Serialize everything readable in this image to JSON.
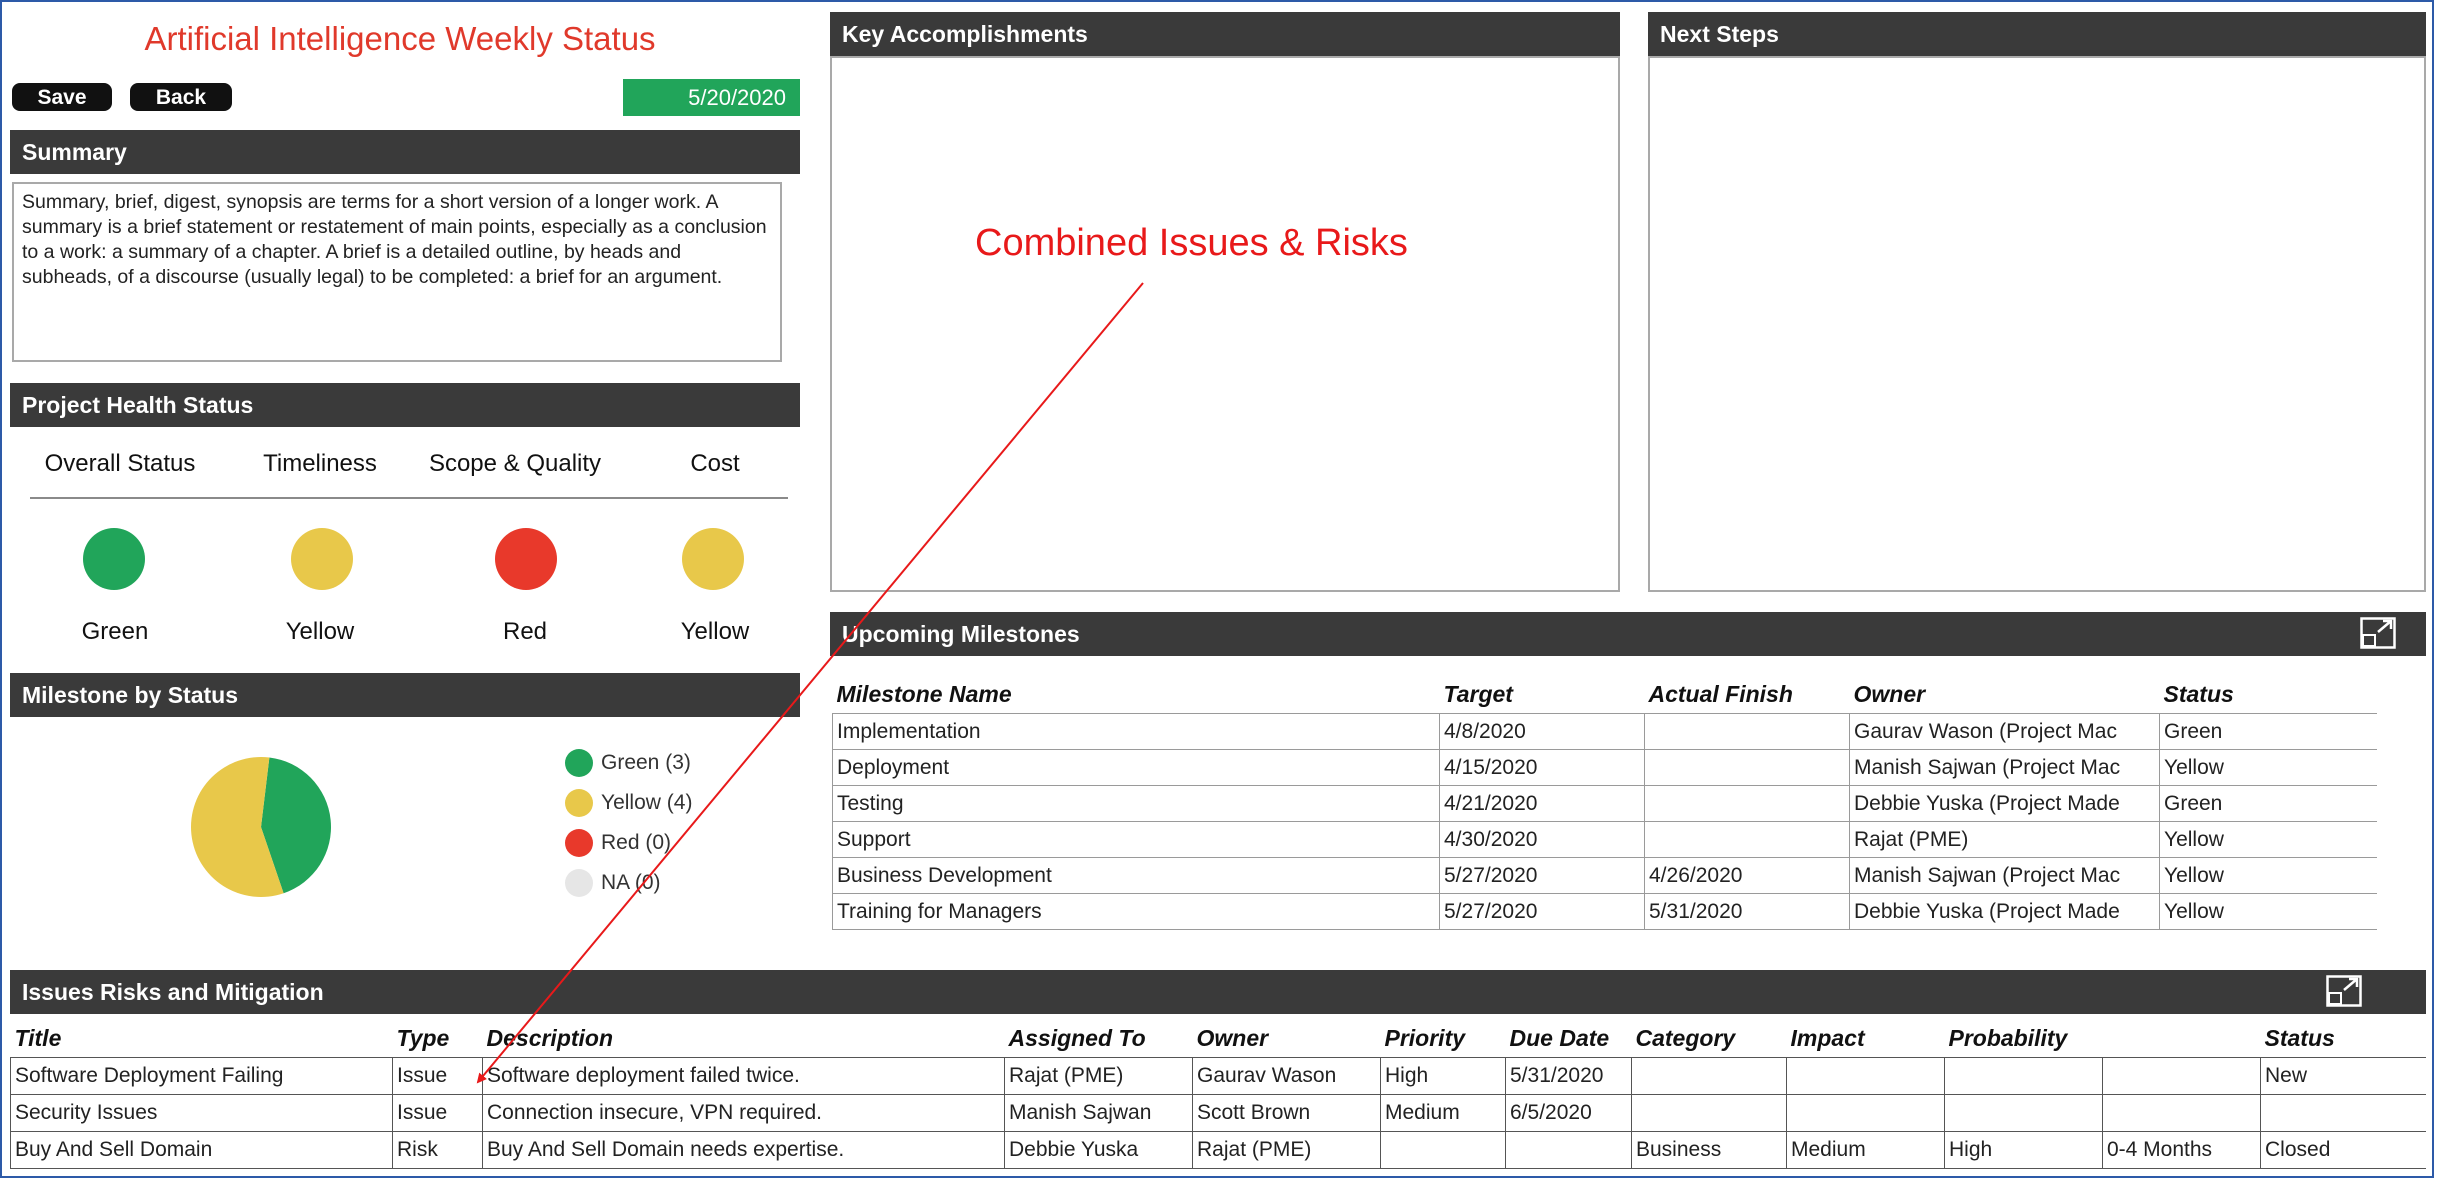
{
  "page_title": "Artificial Intelligence Weekly Status",
  "buttons": {
    "save": "Save",
    "back": "Back"
  },
  "date": "5/20/2020",
  "summary": {
    "header": "Summary",
    "text": "Summary, brief, digest, synopsis are terms for a short version of a longer work. A summary is a brief statement or restatement of main points, especially as a conclusion to a work: a summary of a chapter. A brief is a detailed outline, by heads and subheads, of a discourse (usually legal) to be completed: a brief for an argument."
  },
  "health": {
    "header": "Project Health Status",
    "columns": [
      {
        "label": "Overall Status",
        "status": "Green",
        "color": "#21a55a"
      },
      {
        "label": "Timeliness",
        "status": "Yellow",
        "color": "#e8c84a"
      },
      {
        "label": "Scope & Quality",
        "status": "Red",
        "color": "#e8392b"
      },
      {
        "label": "Cost",
        "status": "Yellow",
        "color": "#e8c84a"
      }
    ]
  },
  "milestone_status": {
    "header": "Milestone by Status",
    "legend": [
      {
        "label": "Green (3)",
        "color": "#21a55a"
      },
      {
        "label": "Yellow (4)",
        "color": "#e8c84a"
      },
      {
        "label": "Red (0)",
        "color": "#e8392b"
      },
      {
        "label": "NA (0)",
        "color": "#e6e6e6"
      }
    ],
    "chart_data": {
      "type": "pie",
      "categories": [
        "Green",
        "Yellow",
        "Red",
        "NA"
      ],
      "values": [
        3,
        4,
        0,
        0
      ],
      "colors": [
        "#21a55a",
        "#e8c84a",
        "#e8392b",
        "#e6e6e6"
      ]
    }
  },
  "key_accomplishments": {
    "header": "Key Accomplishments"
  },
  "next_steps": {
    "header": "Next Steps"
  },
  "annotation": "Combined Issues & Risks",
  "milestones": {
    "header": "Upcoming Milestones",
    "columns": [
      "Milestone Name",
      "Target",
      "Actual Finish",
      "Owner",
      "Status"
    ],
    "rows": [
      [
        "Implementation",
        "4/8/2020",
        "",
        "Gaurav Wason (Project Mac",
        "Green"
      ],
      [
        "Deployment",
        "4/15/2020",
        "",
        "Manish Sajwan (Project Mac",
        "Yellow"
      ],
      [
        "Testing",
        "4/21/2020",
        "",
        "Debbie Yuska (Project Made",
        "Green"
      ],
      [
        "Support",
        "4/30/2020",
        "",
        "Rajat (PME)",
        "Yellow"
      ],
      [
        "Business Development",
        "5/27/2020",
        "4/26/2020",
        "Manish Sajwan (Project Mac",
        "Yellow"
      ],
      [
        "Training for Managers",
        "5/27/2020",
        "5/31/2020",
        "Debbie Yuska (Project Made",
        "Yellow"
      ]
    ]
  },
  "issues": {
    "header": "Issues Risks and Mitigation",
    "columns": [
      "Title",
      "Type",
      "Description",
      "Assigned To",
      "Owner",
      "Priority",
      "Due Date",
      "Category",
      "Impact",
      "Probability",
      "",
      "Status"
    ],
    "rows": [
      [
        "Software Deployment Failing",
        "Issue",
        "Software deployment failed twice.",
        "Rajat (PME)",
        "Gaurav Wason",
        "High",
        "5/31/2020",
        "",
        "",
        "",
        "",
        "New"
      ],
      [
        "Security Issues",
        "Issue",
        "Connection insecure, VPN required.",
        "Manish Sajwan",
        "Scott Brown",
        "Medium",
        "6/5/2020",
        "",
        "",
        "",
        "",
        ""
      ],
      [
        "Buy And Sell Domain",
        "Risk",
        "Buy And Sell Domain needs expertise.",
        "Debbie Yuska",
        "Rajat (PME)",
        "",
        "",
        "Business",
        "Medium",
        "High",
        "0-4 Months",
        "Closed"
      ]
    ]
  },
  "icons": {
    "expand": "expand-icon"
  }
}
